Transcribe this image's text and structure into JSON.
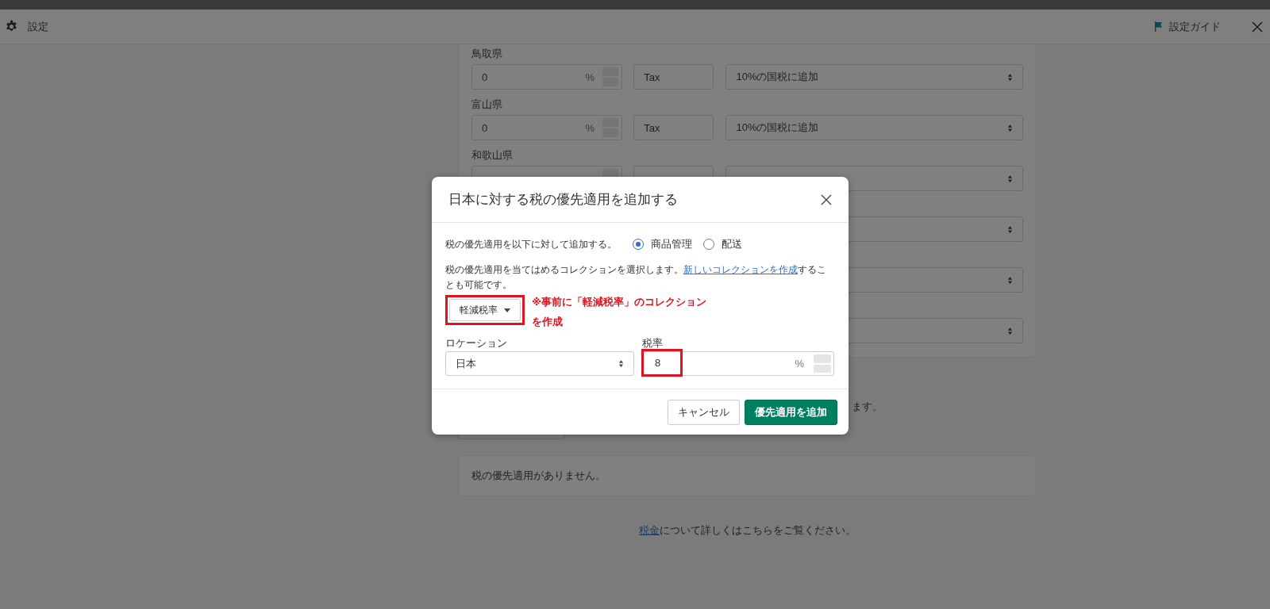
{
  "header": {
    "title": "設定",
    "guide": "設定ガイド"
  },
  "tax_rows": [
    {
      "kind": "full",
      "label": "鳥取県",
      "rate": "0",
      "unit": "%",
      "name": "Tax",
      "mode": "10%の国税に追加"
    },
    {
      "kind": "full",
      "label": "富山県",
      "rate": "0",
      "unit": "%",
      "name": "Tax",
      "mode": "10%の国税に追加"
    },
    {
      "kind": "covered",
      "label": "和歌山県"
    },
    {
      "kind": "covered"
    },
    {
      "kind": "covered"
    },
    {
      "kind": "covered"
    }
  ],
  "override_hint": "ます。",
  "empty_message": "税の優先適用がありません。",
  "help": {
    "link": "税金",
    "text": "について詳しくはこちらをご覧ください。"
  },
  "modal": {
    "title": "日本に対する税の優先適用を追加する",
    "apply_to": {
      "label": "税の優先適用を以下に対して追加する。",
      "options": [
        {
          "label": "商品管理",
          "selected": true
        },
        {
          "label": "配送",
          "selected": false
        }
      ]
    },
    "collection_text": {
      "before": "税の優先適用を当てはめるコレクションを選択します。",
      "link": "新しいコレクションを作成",
      "after": "することも可能です。"
    },
    "collection_button": "軽減税率",
    "note": "※事前に「軽減税率」のコレクションを作成",
    "location": {
      "label": "ロケーション",
      "value": "日本"
    },
    "rate": {
      "label": "税率",
      "value": "8",
      "unit": "%"
    },
    "buttons": [
      {
        "label": "キャンセル",
        "kind": "secondary"
      },
      {
        "label": "優先適用を追加",
        "kind": "primary"
      }
    ]
  }
}
